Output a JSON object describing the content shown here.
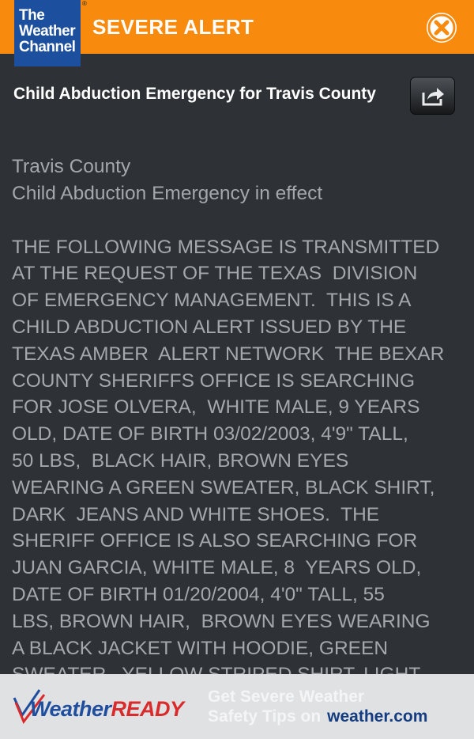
{
  "header": {
    "logo_lines": [
      "The",
      "Weather",
      "Channel"
    ],
    "alert_title": "SEVERE ALERT"
  },
  "alert": {
    "headline": "Child Abduction Emergency for Travis County",
    "area": "Travis County",
    "status": "Child Abduction Emergency in effect",
    "message_lines": [
      "THE FOLLOWING MESSAGE IS TRANSMITTED",
      "AT THE REQUEST OF THE TEXAS  DIVISION",
      "OF EMERGENCY MANAGEMENT.  THIS IS A",
      "CHILD ABDUCTION ALERT ISSUED BY THE",
      "TEXAS AMBER  ALERT NETWORK  THE BEXAR",
      "COUNTY SHERIFFS OFFICE IS SEARCHING",
      "FOR JOSE OLVERA,  WHITE MALE, 9 YEARS",
      "OLD, DATE OF BIRTH 03/02/2003, 4'9\" TALL,",
      "50 LBS,  BLACK HAIR, BROWN EYES",
      "WEARING A GREEN SWEATER, BLACK SHIRT,",
      "DARK  JEANS AND WHITE SHOES.  THE",
      "SHERIFF OFFICE IS ALSO SEARCHING FOR",
      "JUAN GARCIA, WHITE MALE, 8  YEARS OLD,",
      "DATE OF BIRTH 01/20/2004, 4'0\" TALL, 55",
      "LBS, BROWN HAIR,  BROWN EYES WEARING",
      "A BLACK JACKET WITH HOODIE, GREEN",
      "SWEATER,  YELLOW STRIPED SHIRT, LIGHT"
    ]
  },
  "footer": {
    "brand_weather": "Weather",
    "brand_ready": "READY",
    "tip_line1": "Get Severe Weather",
    "tip_line2": "Safety Tips on",
    "site": "weather.com"
  },
  "icons": {
    "close": "close-icon",
    "share": "share-icon"
  },
  "colors": {
    "header_bg": "#f88a0e",
    "logo_bg": "#1d4f9f",
    "body_bg": "#2e3236",
    "text_muted": "#a4a7ab",
    "footer_bg": "#e0e1e3"
  }
}
